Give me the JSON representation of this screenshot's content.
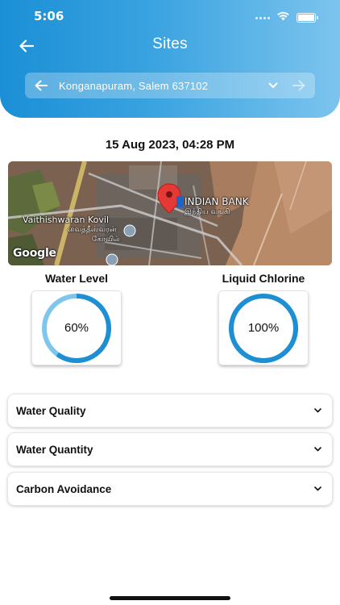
{
  "status": {
    "time": "5:06"
  },
  "header": {
    "title": "Sites"
  },
  "site_selector": {
    "name": "Konganapuram, Salem 637102"
  },
  "reading": {
    "timestamp": "15 Aug 2023, 04:28 PM"
  },
  "map": {
    "bank_label": "INDIAN BANK",
    "bank_label_ta": "இந்திய வங்கி",
    "temple_label": "Vaithishwaran Kovil",
    "temple_label_ta": "வைத்தீஸ்வரன்",
    "temple_label_ta2": "கோவில்",
    "attribution": "Google"
  },
  "gauges": [
    {
      "title": "Water Level",
      "value_text": "60%",
      "fraction": 0.6
    },
    {
      "title": "Liquid Chlorine",
      "value_text": "100%",
      "fraction": 1.0
    }
  ],
  "sections": [
    {
      "label": "Water Quality"
    },
    {
      "label": "Water Quantity"
    },
    {
      "label": "Carbon Avoidance"
    }
  ],
  "colors": {
    "accent": "#1b8fd6",
    "gauge_fill": "#1f8fd4",
    "gauge_track": "#7fc6ee"
  }
}
